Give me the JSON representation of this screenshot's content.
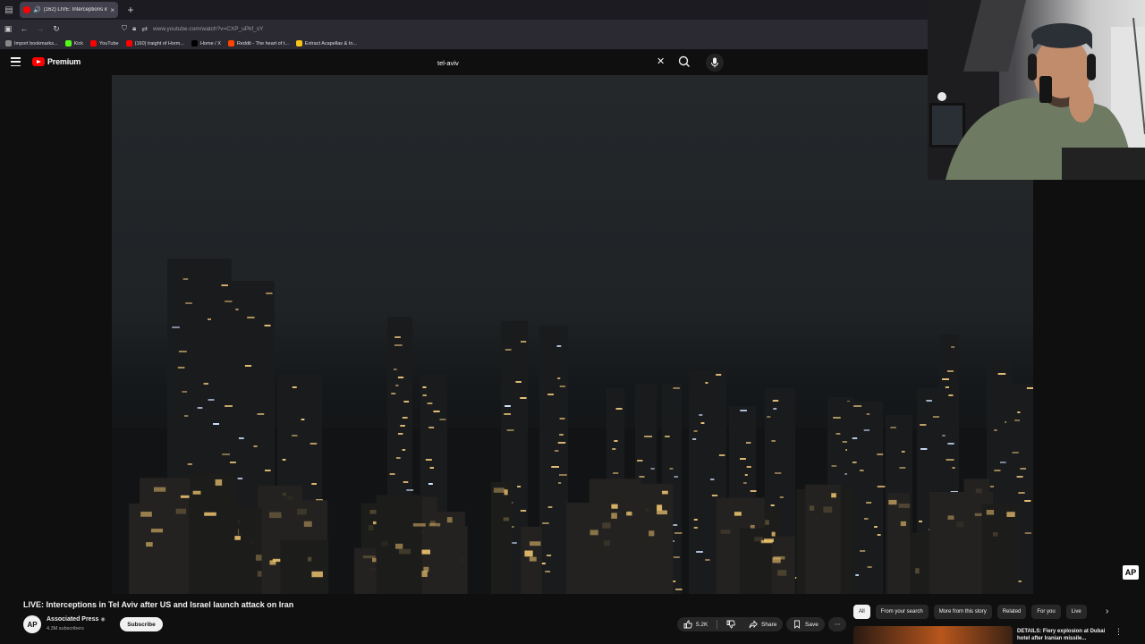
{
  "browser": {
    "tab": {
      "title": "(162) LIVE: Interceptions in",
      "close": "×"
    },
    "new_tab": "+",
    "url": "www.youtube.com/watch?v=CXP_uPkf_sY",
    "bookmarks": [
      {
        "label": "Import bookmarks...",
        "color": "#888888"
      },
      {
        "label": "Kick",
        "color": "#53fc18"
      },
      {
        "label": "YouTube",
        "color": "#ff0000"
      },
      {
        "label": "(160) traight of Horm...",
        "color": "#ff0000"
      },
      {
        "label": "Home / X",
        "color": "#000000"
      },
      {
        "label": "Reddit - The heart of t...",
        "color": "#ff4500"
      },
      {
        "label": "Extract Acapellas & In...",
        "color": "#f5c518"
      }
    ]
  },
  "youtube": {
    "logo_word": "Premium",
    "search_query": "tel-aviv",
    "search_clear": "✕",
    "accent": "#ff0000"
  },
  "video": {
    "title": "LIVE: Interceptions in Tel Aviv after US and Israel launch attack on Iran",
    "watermark": "AP"
  },
  "channel": {
    "avatar_text": "AP",
    "name": "Associated Press",
    "verified": "◉",
    "subscribers": "4.3M subscribers",
    "subscribe_label": "Subscribe"
  },
  "actions": {
    "likes": "5.2K",
    "share": "Share",
    "save": "Save",
    "more": "⋯"
  },
  "chips": [
    "All",
    "From your search",
    "More from this story",
    "Related",
    "For you",
    "Live"
  ],
  "chips_next": "›",
  "recommended": {
    "title": "DETAILS: Fiery explosion at Dubai hotel after Iranian missile...",
    "more": "⋮"
  }
}
